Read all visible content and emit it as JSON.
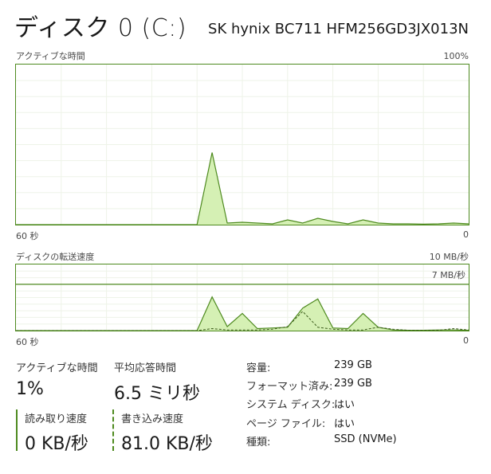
{
  "header": {
    "title": "ディスク 0 (C:)",
    "model": "SK hynix BC711 HFM256GD3JX013N"
  },
  "activity_graph": {
    "label": "アクティブな時間",
    "max_label": "100%",
    "x_left_label": "60 秒",
    "x_right_label": "0"
  },
  "transfer_graph": {
    "label": "ディスクの転送速度",
    "max_label": "10 MB/秒",
    "line_label": "7 MB/秒",
    "x_left_label": "60 秒",
    "x_right_label": "0"
  },
  "chart_data": [
    {
      "type": "area",
      "title": "アクティブな時間",
      "x": [
        60,
        56,
        52,
        48,
        44,
        40,
        36,
        34,
        32,
        30,
        28,
        26,
        24,
        22,
        20,
        18,
        16,
        14,
        12,
        10,
        8,
        6,
        4,
        2,
        0
      ],
      "values": [
        0,
        0,
        0,
        0,
        0,
        0,
        0,
        45,
        1,
        1.5,
        1,
        0.5,
        3,
        1,
        4,
        2,
        0.5,
        3,
        1,
        0.5,
        0.5,
        0.3,
        0.5,
        1,
        0.5
      ],
      "ylim": [
        0,
        100
      ],
      "grid": true
    },
    {
      "type": "area",
      "title": "ディスクの転送速度",
      "x": [
        60,
        56,
        52,
        48,
        44,
        40,
        36,
        34,
        32,
        30,
        28,
        26,
        24,
        22,
        20,
        18,
        16,
        14,
        12,
        10,
        8,
        6,
        4,
        2,
        0
      ],
      "series": [
        {
          "values": [
            0,
            0,
            0,
            0,
            0,
            0,
            0,
            5.1,
            0.6,
            2.6,
            0.3,
            0.4,
            0.5,
            3.4,
            4.8,
            0.4,
            0.3,
            2.6,
            0.5,
            0.1,
            0.05,
            0.05,
            0.1,
            0.1,
            0.05
          ]
        },
        {
          "values": [
            0,
            0,
            0,
            0,
            0,
            0,
            0,
            0.3,
            0.1,
            0.1,
            0.1,
            0.2,
            0.6,
            2.9,
            0.5,
            0.2,
            0.1,
            0.1,
            0.5,
            0.2,
            0.05,
            0.05,
            0.05,
            0.3,
            0.1
          ]
        }
      ],
      "reference_line": 7,
      "ylim": [
        0,
        10
      ],
      "grid": true
    }
  ],
  "stats": {
    "active_time_label": "アクティブな時間",
    "active_time_value": "1%",
    "avg_response_label": "平均応答時間",
    "avg_response_value": "6.5 ミリ秒",
    "read_speed_label": "読み取り速度",
    "read_speed_value": "0 KB/秒",
    "write_speed_label": "書き込み速度",
    "write_speed_value": "81.0 KB/秒"
  },
  "info": [
    {
      "key": "容量:",
      "value": "239 GB"
    },
    {
      "key": "フォーマット済み:",
      "value": "239 GB"
    },
    {
      "key": "システム ディスク:",
      "value": "はい"
    },
    {
      "key": "ページ ファイル:",
      "value": "はい"
    },
    {
      "key": "種類:",
      "value": "SSD (NVMe)"
    }
  ],
  "colors": {
    "accent": "#4e8a1f",
    "fill": "#d5f0b4",
    "grid": "#eef3e8"
  }
}
